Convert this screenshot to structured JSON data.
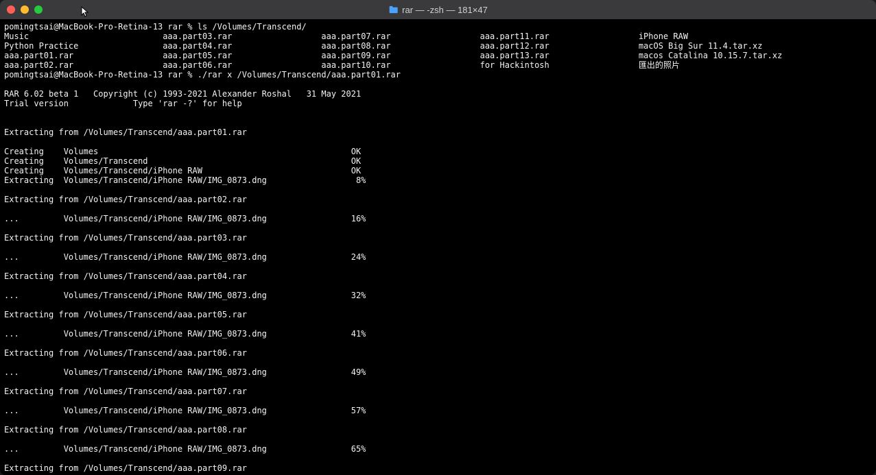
{
  "window": {
    "title": "rar — -zsh — 181×47"
  },
  "terminal": {
    "prompt1": "pomingtsai@MacBook-Pro-Retina-13 rar % ls /Volumes/Transcend/",
    "ls_output": {
      "col1": [
        "Music",
        "Python Practice",
        "aaa.part01.rar",
        "aaa.part02.rar"
      ],
      "col2": [
        "aaa.part03.rar",
        "aaa.part04.rar",
        "aaa.part05.rar",
        "aaa.part06.rar"
      ],
      "col3": [
        "aaa.part07.rar",
        "aaa.part08.rar",
        "aaa.part09.rar",
        "aaa.part10.rar"
      ],
      "col4": [
        "aaa.part11.rar",
        "aaa.part12.rar",
        "aaa.part13.rar",
        "for Hackintosh"
      ],
      "col5": [
        "iPhone RAW",
        "macOS Big Sur 11.4.tar.xz",
        "macos Catalina 10.15.7.tar.xz",
        "匯出的照片"
      ]
    },
    "prompt2": "pomingtsai@MacBook-Pro-Retina-13 rar % ./rar x /Volumes/Transcend/aaa.part01.rar",
    "blank1": "",
    "rar_header1": "RAR 6.02 beta 1   Copyright (c) 1993-2021 Alexander Roshal   31 May 2021",
    "rar_header2": "Trial version             Type 'rar -?' for help",
    "blank2": "",
    "blank3": "",
    "extract1": "Extracting from /Volumes/Transcend/aaa.part01.rar",
    "blank4": "",
    "create1": "Creating    Volumes                                                   OK",
    "create2": "Creating    Volumes/Transcend                                         OK",
    "create3": "Creating    Volumes/Transcend/iPhone RAW                              OK",
    "extr_line1": "Extracting  Volumes/Transcend/iPhone RAW/IMG_0873.dng                  8%",
    "blank5": "",
    "extract2": "Extracting from /Volumes/Transcend/aaa.part02.rar",
    "blank6": "",
    "prog2": "...         Volumes/Transcend/iPhone RAW/IMG_0873.dng                 16%",
    "blank7": "",
    "extract3": "Extracting from /Volumes/Transcend/aaa.part03.rar",
    "blank8": "",
    "prog3": "...         Volumes/Transcend/iPhone RAW/IMG_0873.dng                 24%",
    "blank9": "",
    "extract4": "Extracting from /Volumes/Transcend/aaa.part04.rar",
    "blank10": "",
    "prog4": "...         Volumes/Transcend/iPhone RAW/IMG_0873.dng                 32%",
    "blank11": "",
    "extract5": "Extracting from /Volumes/Transcend/aaa.part05.rar",
    "blank12": "",
    "prog5": "...         Volumes/Transcend/iPhone RAW/IMG_0873.dng                 41%",
    "blank13": "",
    "extract6": "Extracting from /Volumes/Transcend/aaa.part06.rar",
    "blank14": "",
    "prog6": "...         Volumes/Transcend/iPhone RAW/IMG_0873.dng                 49%",
    "blank15": "",
    "extract7": "Extracting from /Volumes/Transcend/aaa.part07.rar",
    "blank16": "",
    "prog7": "...         Volumes/Transcend/iPhone RAW/IMG_0873.dng                 57%",
    "blank17": "",
    "extract8": "Extracting from /Volumes/Transcend/aaa.part08.rar",
    "blank18": "",
    "prog8": "...         Volumes/Transcend/iPhone RAW/IMG_0873.dng                 65%",
    "blank19": "",
    "extract9": "Extracting from /Volumes/Transcend/aaa.part09.rar"
  }
}
